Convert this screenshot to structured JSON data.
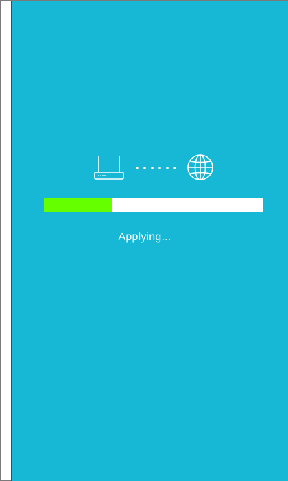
{
  "colors": {
    "panel_background": "#17b8d6",
    "progress_fill": "#66ff00",
    "progress_track": "#ffffff",
    "text": "#ffffff"
  },
  "icons": {
    "left": "router-icon",
    "middle": "connection-dots",
    "right": "globe-icon"
  },
  "progress": {
    "fraction": 0.31
  },
  "status": {
    "label": "Applying..."
  }
}
